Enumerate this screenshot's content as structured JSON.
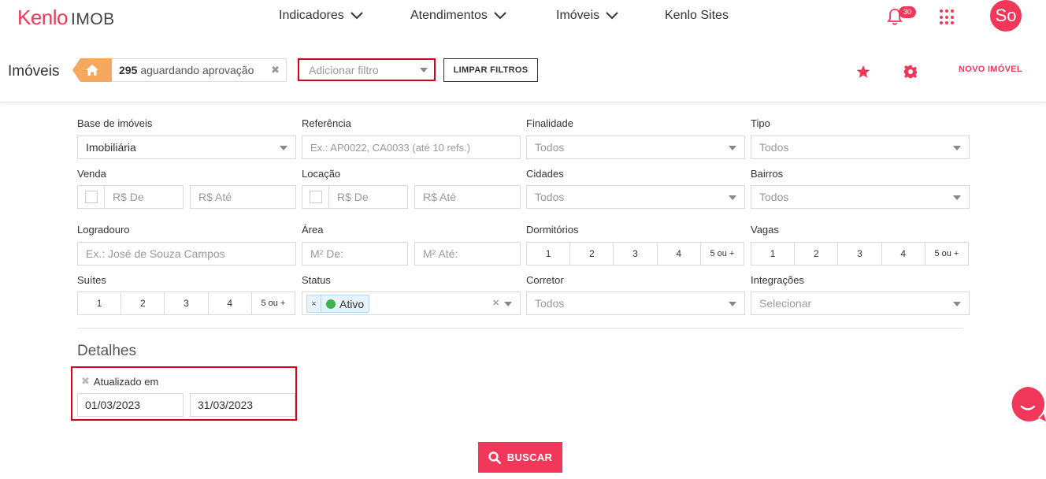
{
  "brand": {
    "logo_main": "Kenlo",
    "logo_sub": "IMOB",
    "accent": "#f2385a"
  },
  "nav": {
    "items": [
      {
        "label": "Indicadores",
        "dropdown": true
      },
      {
        "label": "Atendimentos",
        "dropdown": true
      },
      {
        "label": "Imóveis",
        "dropdown": true
      },
      {
        "label": "Kenlo Sites",
        "dropdown": false
      }
    ],
    "notifications": "30",
    "avatar": "So"
  },
  "header": {
    "title": "Imóveis",
    "approval_count": "295",
    "approval_text": "aguardando aprovação",
    "filter_placeholder": "Adicionar filtro",
    "clear_label": "LIMPAR FILTROS",
    "new_label": "NOVO IMÓVEL"
  },
  "form": {
    "base_label": "Base de imóveis",
    "base_value": "Imobiliária",
    "ref_label": "Referência",
    "ref_placeholder": "Ex.: AP0022, CA0033 (até 10 refs.)",
    "finalidade_label": "Finalidade",
    "finalidade_value": "Todos",
    "tipo_label": "Tipo",
    "tipo_value": "Todos",
    "venda_label": "Venda",
    "venda_from": "R$ De",
    "venda_to": "R$ Até",
    "locacao_label": "Locação",
    "locacao_from": "R$ De",
    "locacao_to": "R$ Até",
    "cidades_label": "Cidades",
    "cidades_value": "Todos",
    "bairros_label": "Bairros",
    "bairros_value": "Todos",
    "logradouro_label": "Logradouro",
    "logradouro_placeholder": "Ex.: José de Souza Campos",
    "area_label": "Área",
    "area_from": "M² De:",
    "area_to": "M² Até:",
    "dormitorios_label": "Dormitórios",
    "vagas_label": "Vagas",
    "suites_label": "Suítes",
    "counts": [
      "1",
      "2",
      "3",
      "4",
      "5 ou +"
    ],
    "status_label": "Status",
    "status_tag_x": "×",
    "status_value": "Ativo",
    "status_clear": "×",
    "corretor_label": "Corretor",
    "corretor_value": "Todos",
    "integracoes_label": "Integrações",
    "integracoes_value": "Selecionar"
  },
  "details": {
    "title": "Detalhes",
    "updated_label": "Atualizado em",
    "date_from": "01/03/2023",
    "date_to": "31/03/2023"
  },
  "search_label": "BUSCAR"
}
